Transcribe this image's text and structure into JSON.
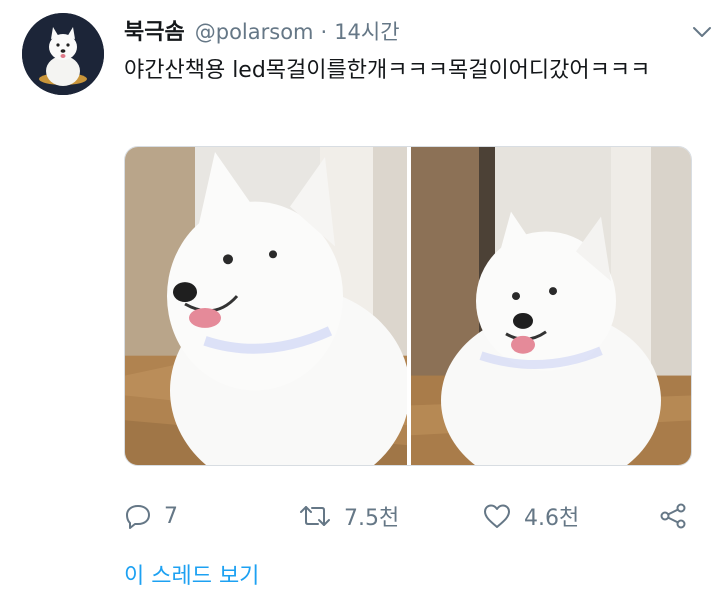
{
  "tweet": {
    "display_name": "북극솜",
    "handle": "@polarsom",
    "separator": "·",
    "time": "14시간",
    "text": "야간산책용 led목걸이를한개ㅋㅋㅋ목걸이어디갔어ㅋㅋㅋ"
  },
  "icons": {
    "more": "chevron-down-icon",
    "reply": "reply-icon",
    "retweet": "retweet-icon",
    "like": "heart-icon",
    "share": "share-icon"
  },
  "actions": {
    "reply_count": "7",
    "retweet_count": "7.5천",
    "like_count": "4.6천"
  },
  "footer": {
    "show_thread": "이 스레드 보기"
  },
  "colors": {
    "text": "#14171a",
    "secondary": "#657786",
    "link": "#1da1f2"
  }
}
